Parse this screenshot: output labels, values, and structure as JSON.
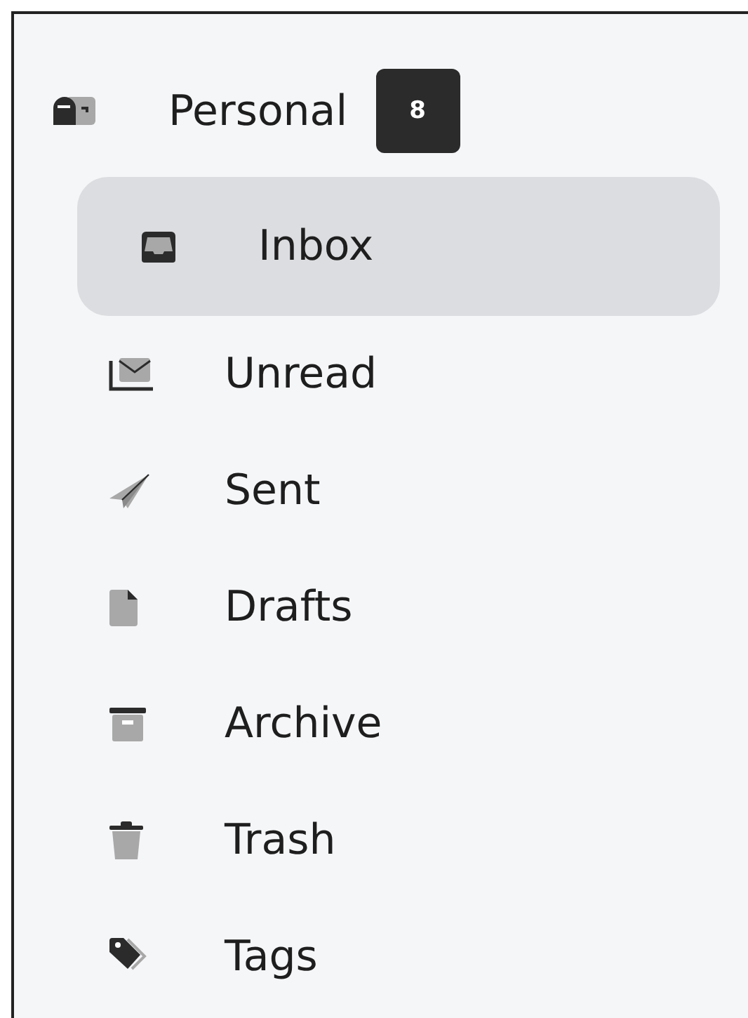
{
  "account": {
    "label": "Personal",
    "badge": "8"
  },
  "folders": [
    {
      "label": "Inbox",
      "kind": "inbox",
      "selected": true
    },
    {
      "label": "Unread",
      "kind": "unread",
      "selected": false
    },
    {
      "label": "Sent",
      "kind": "sent",
      "selected": false
    },
    {
      "label": "Drafts",
      "kind": "drafts",
      "selected": false
    },
    {
      "label": "Archive",
      "kind": "archive",
      "selected": false
    },
    {
      "label": "Trash",
      "kind": "trash",
      "selected": false
    },
    {
      "label": "Tags",
      "kind": "tags",
      "selected": false
    }
  ]
}
